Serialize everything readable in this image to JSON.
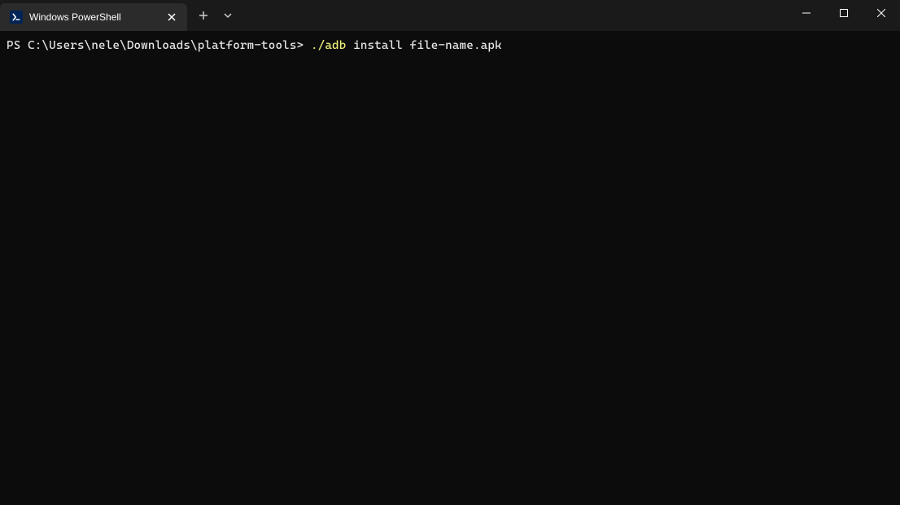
{
  "tab": {
    "title": "Windows PowerShell"
  },
  "terminal": {
    "prompt": "PS C:\\Users\\nele\\Downloads\\platform-tools> ",
    "command_exec": "./adb",
    "command_args": " install file-name.apk"
  }
}
